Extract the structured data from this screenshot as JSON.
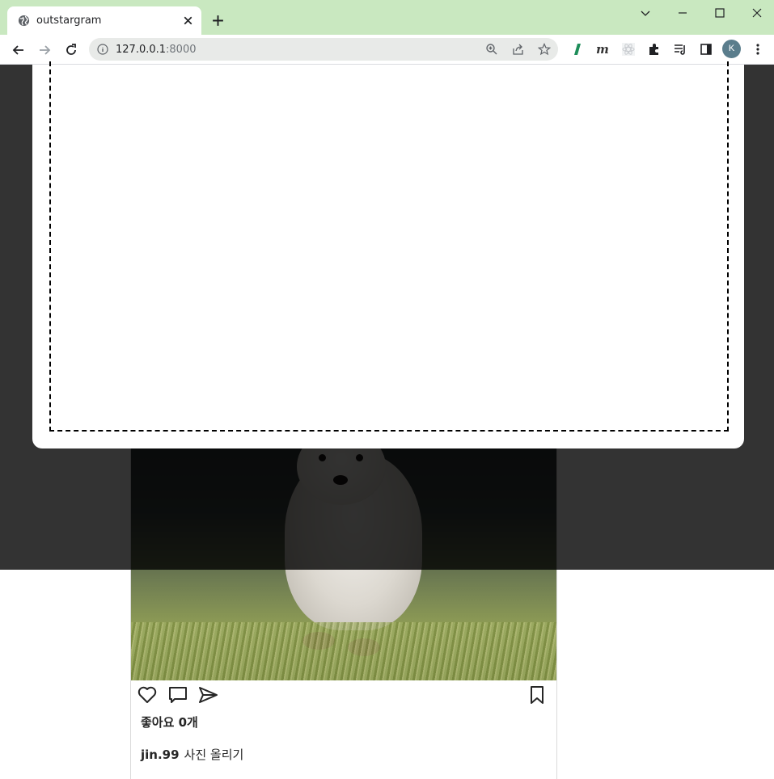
{
  "browser": {
    "tab_title": "outstargram",
    "url_host": "127.0.0.1",
    "url_port": ":8000",
    "profile_initial": "K"
  },
  "post": {
    "likes_label": "좋아요 0개",
    "username": "jin.99",
    "caption": "사진 올리기"
  },
  "modal": {
    "overlay_color": "#000000cc"
  },
  "colors": {
    "tab_strip": "#c9e8c0",
    "omnibox": "#e8eae8",
    "card_border": "#dbdbdb",
    "text": "#262626"
  },
  "icons": [
    "globe-icon",
    "close-icon",
    "plus-icon",
    "chevron-down-icon",
    "minimize-icon",
    "maximize-icon",
    "window-close-icon",
    "back-icon",
    "forward-icon",
    "reload-icon",
    "info-icon",
    "zoom-icon",
    "share-icon",
    "star-icon",
    "extensions-icon",
    "media-icon",
    "sidepanel-icon",
    "menu-icon",
    "heart-icon",
    "comment-icon",
    "send-icon",
    "bookmark-icon"
  ]
}
